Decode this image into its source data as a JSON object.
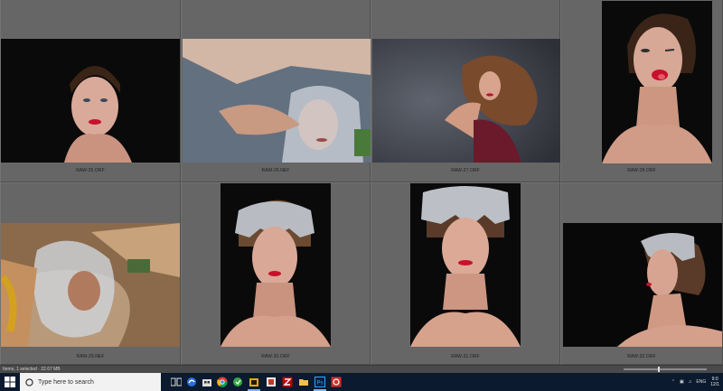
{
  "thumbnails": [
    {
      "filename": "RAW-25.ORF"
    },
    {
      "filename": "RAW-26.NEF"
    },
    {
      "filename": "RAW-27.ORF"
    },
    {
      "filename": "RAW-28.ORF"
    },
    {
      "filename": "RAW-29.NEF"
    },
    {
      "filename": "RAW-30.ORF"
    },
    {
      "filename": "RAW-31.ORF"
    },
    {
      "filename": "RAW-32.ORF"
    }
  ],
  "status": {
    "text": "Items, 1 selected · 22.67 MB"
  },
  "taskbar": {
    "search_placeholder": "Type here to search",
    "apps": [
      "task-view-icon",
      "edge-icon",
      "store-icon",
      "chrome-icon",
      "app-green-icon",
      "folder-app-icon",
      "media-app-icon",
      "filezilla-icon",
      "file-explorer-icon",
      "photoshop-icon",
      "app-red-icon"
    ],
    "tray": {
      "language": "ENG",
      "time": "9:0",
      "date": "12/1"
    }
  },
  "colors": {
    "grid_bg": "#666666",
    "taskbar_bg": "#0b1a2e",
    "accent": "#7fb4ff"
  }
}
